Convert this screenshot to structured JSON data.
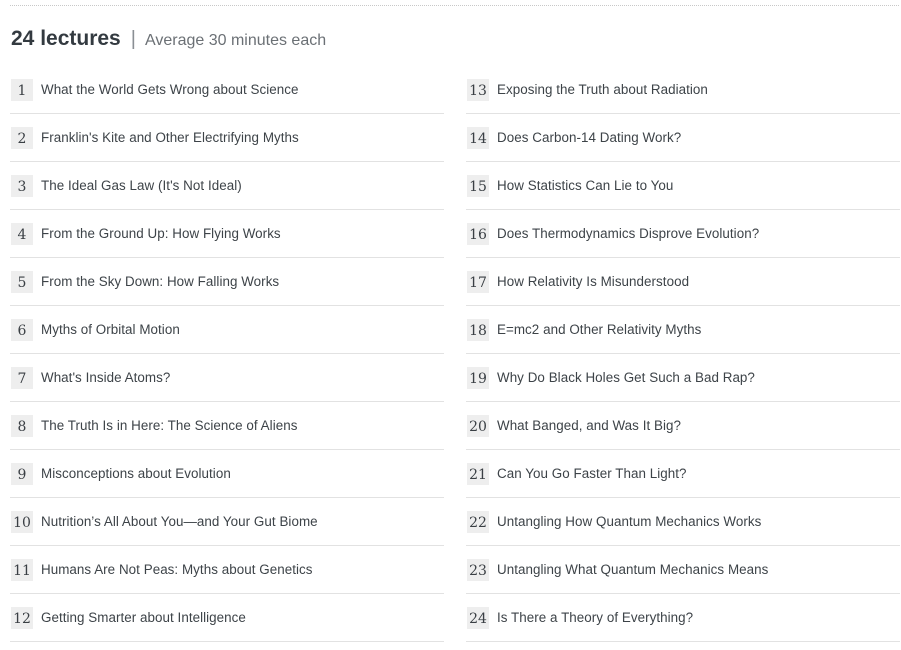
{
  "header": {
    "count_label": "24 lectures",
    "separator": "|",
    "average_label": "Average 30 minutes each"
  },
  "lectures": [
    {
      "num": "1",
      "title": "What the World Gets Wrong about Science"
    },
    {
      "num": "2",
      "title": "Franklin's Kite and Other Electrifying Myths"
    },
    {
      "num": "3",
      "title": "The Ideal Gas Law (It's Not Ideal)"
    },
    {
      "num": "4",
      "title": "From the Ground Up: How Flying Works"
    },
    {
      "num": "5",
      "title": "From the Sky Down: How Falling Works"
    },
    {
      "num": "6",
      "title": "Myths of Orbital Motion"
    },
    {
      "num": "7",
      "title": "What's Inside Atoms?"
    },
    {
      "num": "8",
      "title": "The Truth Is in Here: The Science of Aliens"
    },
    {
      "num": "9",
      "title": "Misconceptions about Evolution"
    },
    {
      "num": "10",
      "title": "Nutrition’s All About You—and Your Gut Biome"
    },
    {
      "num": "11",
      "title": "Humans Are Not Peas: Myths about Genetics"
    },
    {
      "num": "12",
      "title": "Getting Smarter about Intelligence"
    },
    {
      "num": "13",
      "title": "Exposing the Truth about Radiation"
    },
    {
      "num": "14",
      "title": "Does Carbon-14 Dating Work?"
    },
    {
      "num": "15",
      "title": "How Statistics Can Lie to You"
    },
    {
      "num": "16",
      "title": "Does Thermodynamics Disprove Evolution?"
    },
    {
      "num": "17",
      "title": "How Relativity Is Misunderstood"
    },
    {
      "num": "18",
      "title": "E=mc2 and Other Relativity Myths"
    },
    {
      "num": "19",
      "title": "Why Do Black Holes Get Such a Bad Rap?"
    },
    {
      "num": "20",
      "title": "What Banged, and Was It Big?"
    },
    {
      "num": "21",
      "title": "Can You Go Faster Than Light?"
    },
    {
      "num": "22",
      "title": "Untangling How Quantum Mechanics Works"
    },
    {
      "num": "23",
      "title": "Untangling What Quantum Mechanics Means"
    },
    {
      "num": "24",
      "title": "Is There a Theory of Everything?"
    }
  ]
}
